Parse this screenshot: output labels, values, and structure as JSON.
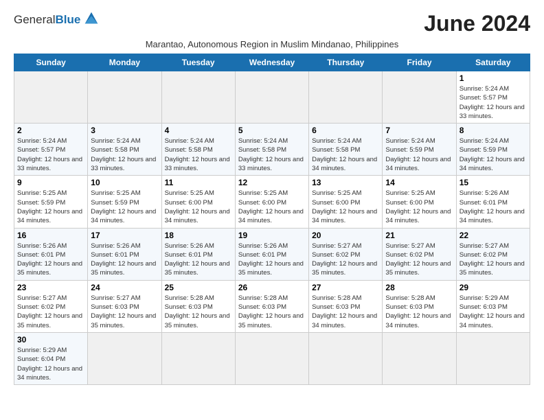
{
  "header": {
    "logo_text_general": "General",
    "logo_text_blue": "Blue",
    "month_title": "June 2024",
    "subtitle": "Marantao, Autonomous Region in Muslim Mindanao, Philippines"
  },
  "weekdays": [
    "Sunday",
    "Monday",
    "Tuesday",
    "Wednesday",
    "Thursday",
    "Friday",
    "Saturday"
  ],
  "weeks": [
    {
      "days": [
        {
          "num": "",
          "empty": true
        },
        {
          "num": "",
          "empty": true
        },
        {
          "num": "",
          "empty": true
        },
        {
          "num": "",
          "empty": true
        },
        {
          "num": "",
          "empty": true
        },
        {
          "num": "",
          "empty": true
        },
        {
          "num": "1",
          "sunrise": "Sunrise: 5:24 AM",
          "sunset": "Sunset: 5:57 PM",
          "daylight": "Daylight: 12 hours and 33 minutes."
        }
      ]
    },
    {
      "days": [
        {
          "num": "2",
          "sunrise": "Sunrise: 5:24 AM",
          "sunset": "Sunset: 5:57 PM",
          "daylight": "Daylight: 12 hours and 33 minutes."
        },
        {
          "num": "3",
          "sunrise": "Sunrise: 5:24 AM",
          "sunset": "Sunset: 5:58 PM",
          "daylight": "Daylight: 12 hours and 33 minutes."
        },
        {
          "num": "4",
          "sunrise": "Sunrise: 5:24 AM",
          "sunset": "Sunset: 5:58 PM",
          "daylight": "Daylight: 12 hours and 33 minutes."
        },
        {
          "num": "5",
          "sunrise": "Sunrise: 5:24 AM",
          "sunset": "Sunset: 5:58 PM",
          "daylight": "Daylight: 12 hours and 33 minutes."
        },
        {
          "num": "6",
          "sunrise": "Sunrise: 5:24 AM",
          "sunset": "Sunset: 5:58 PM",
          "daylight": "Daylight: 12 hours and 34 minutes."
        },
        {
          "num": "7",
          "sunrise": "Sunrise: 5:24 AM",
          "sunset": "Sunset: 5:59 PM",
          "daylight": "Daylight: 12 hours and 34 minutes."
        },
        {
          "num": "8",
          "sunrise": "Sunrise: 5:24 AM",
          "sunset": "Sunset: 5:59 PM",
          "daylight": "Daylight: 12 hours and 34 minutes."
        }
      ]
    },
    {
      "days": [
        {
          "num": "9",
          "sunrise": "Sunrise: 5:25 AM",
          "sunset": "Sunset: 5:59 PM",
          "daylight": "Daylight: 12 hours and 34 minutes."
        },
        {
          "num": "10",
          "sunrise": "Sunrise: 5:25 AM",
          "sunset": "Sunset: 5:59 PM",
          "daylight": "Daylight: 12 hours and 34 minutes."
        },
        {
          "num": "11",
          "sunrise": "Sunrise: 5:25 AM",
          "sunset": "Sunset: 6:00 PM",
          "daylight": "Daylight: 12 hours and 34 minutes."
        },
        {
          "num": "12",
          "sunrise": "Sunrise: 5:25 AM",
          "sunset": "Sunset: 6:00 PM",
          "daylight": "Daylight: 12 hours and 34 minutes."
        },
        {
          "num": "13",
          "sunrise": "Sunrise: 5:25 AM",
          "sunset": "Sunset: 6:00 PM",
          "daylight": "Daylight: 12 hours and 34 minutes."
        },
        {
          "num": "14",
          "sunrise": "Sunrise: 5:25 AM",
          "sunset": "Sunset: 6:00 PM",
          "daylight": "Daylight: 12 hours and 34 minutes."
        },
        {
          "num": "15",
          "sunrise": "Sunrise: 5:26 AM",
          "sunset": "Sunset: 6:01 PM",
          "daylight": "Daylight: 12 hours and 34 minutes."
        }
      ]
    },
    {
      "days": [
        {
          "num": "16",
          "sunrise": "Sunrise: 5:26 AM",
          "sunset": "Sunset: 6:01 PM",
          "daylight": "Daylight: 12 hours and 35 minutes."
        },
        {
          "num": "17",
          "sunrise": "Sunrise: 5:26 AM",
          "sunset": "Sunset: 6:01 PM",
          "daylight": "Daylight: 12 hours and 35 minutes."
        },
        {
          "num": "18",
          "sunrise": "Sunrise: 5:26 AM",
          "sunset": "Sunset: 6:01 PM",
          "daylight": "Daylight: 12 hours and 35 minutes."
        },
        {
          "num": "19",
          "sunrise": "Sunrise: 5:26 AM",
          "sunset": "Sunset: 6:01 PM",
          "daylight": "Daylight: 12 hours and 35 minutes."
        },
        {
          "num": "20",
          "sunrise": "Sunrise: 5:27 AM",
          "sunset": "Sunset: 6:02 PM",
          "daylight": "Daylight: 12 hours and 35 minutes."
        },
        {
          "num": "21",
          "sunrise": "Sunrise: 5:27 AM",
          "sunset": "Sunset: 6:02 PM",
          "daylight": "Daylight: 12 hours and 35 minutes."
        },
        {
          "num": "22",
          "sunrise": "Sunrise: 5:27 AM",
          "sunset": "Sunset: 6:02 PM",
          "daylight": "Daylight: 12 hours and 35 minutes."
        }
      ]
    },
    {
      "days": [
        {
          "num": "23",
          "sunrise": "Sunrise: 5:27 AM",
          "sunset": "Sunset: 6:02 PM",
          "daylight": "Daylight: 12 hours and 35 minutes."
        },
        {
          "num": "24",
          "sunrise": "Sunrise: 5:27 AM",
          "sunset": "Sunset: 6:03 PM",
          "daylight": "Daylight: 12 hours and 35 minutes."
        },
        {
          "num": "25",
          "sunrise": "Sunrise: 5:28 AM",
          "sunset": "Sunset: 6:03 PM",
          "daylight": "Daylight: 12 hours and 35 minutes."
        },
        {
          "num": "26",
          "sunrise": "Sunrise: 5:28 AM",
          "sunset": "Sunset: 6:03 PM",
          "daylight": "Daylight: 12 hours and 35 minutes."
        },
        {
          "num": "27",
          "sunrise": "Sunrise: 5:28 AM",
          "sunset": "Sunset: 6:03 PM",
          "daylight": "Daylight: 12 hours and 34 minutes."
        },
        {
          "num": "28",
          "sunrise": "Sunrise: 5:28 AM",
          "sunset": "Sunset: 6:03 PM",
          "daylight": "Daylight: 12 hours and 34 minutes."
        },
        {
          "num": "29",
          "sunrise": "Sunrise: 5:29 AM",
          "sunset": "Sunset: 6:03 PM",
          "daylight": "Daylight: 12 hours and 34 minutes."
        }
      ]
    },
    {
      "days": [
        {
          "num": "30",
          "sunrise": "Sunrise: 5:29 AM",
          "sunset": "Sunset: 6:04 PM",
          "daylight": "Daylight: 12 hours and 34 minutes."
        },
        {
          "num": "",
          "empty": true
        },
        {
          "num": "",
          "empty": true
        },
        {
          "num": "",
          "empty": true
        },
        {
          "num": "",
          "empty": true
        },
        {
          "num": "",
          "empty": true
        },
        {
          "num": "",
          "empty": true
        }
      ]
    }
  ]
}
